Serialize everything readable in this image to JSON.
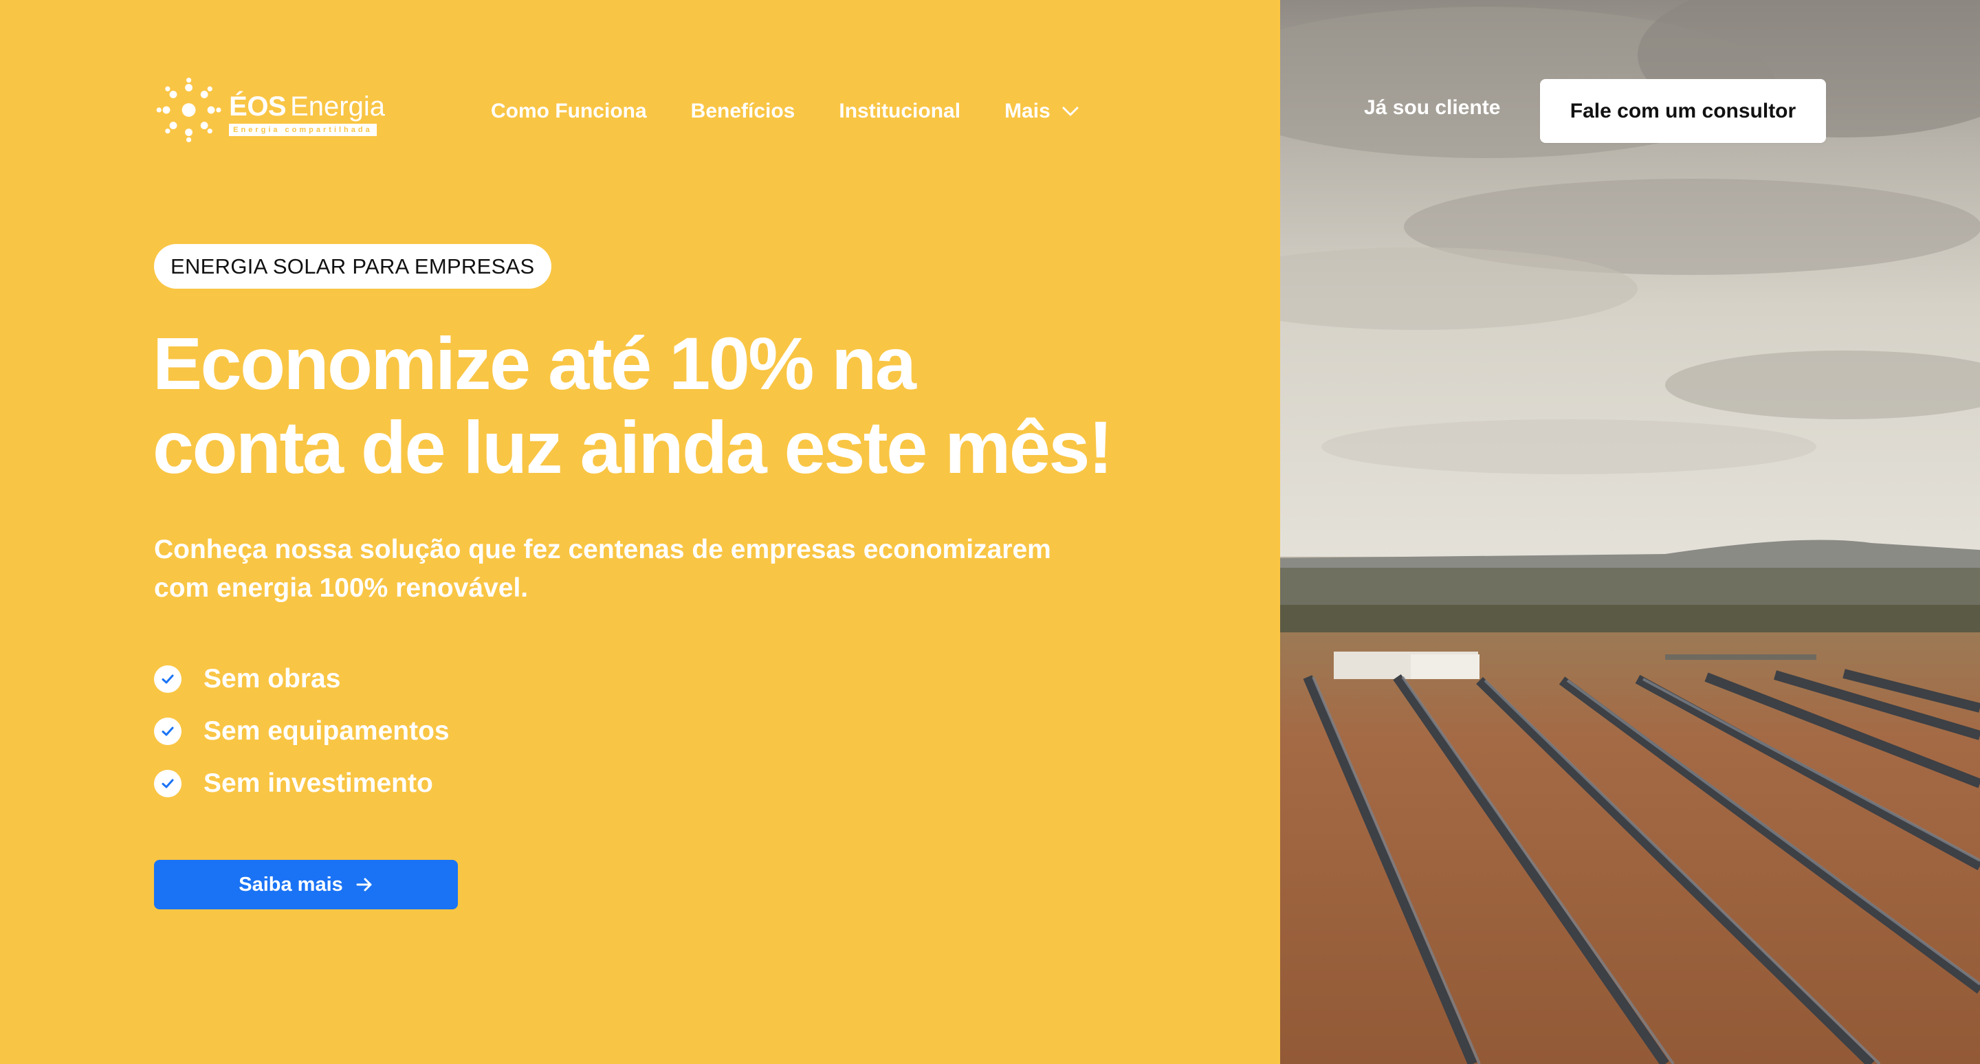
{
  "brand": {
    "name": "ÉOS",
    "name_suffix": "Energia",
    "tagline": "Energia compartilhada"
  },
  "nav": {
    "items": [
      {
        "label": "Como Funciona"
      },
      {
        "label": "Benefícios"
      },
      {
        "label": "Institucional"
      },
      {
        "label": "Mais",
        "icon": "chevron-down-icon"
      }
    ],
    "client_link": "Já sou cliente",
    "consultant_button": "Fale com um consultor"
  },
  "hero": {
    "eyebrow": "ENERGIA SOLAR PARA EMPRESAS",
    "headline_line1": "Economize até 10% na",
    "headline_line2": "conta de luz ainda este mês!",
    "subtitle_line1": "Conheça nossa solução que fez centenas de empresas economizarem",
    "subtitle_line2": "com energia 100% renovável.",
    "features": [
      {
        "label": "Sem obras",
        "icon": "check-circle-icon"
      },
      {
        "label": "Sem equipamentos",
        "icon": "check-circle-icon"
      },
      {
        "label": "Sem investimento",
        "icon": "check-circle-icon"
      }
    ],
    "cta_label": "Saiba mais",
    "cta_icon": "arrow-right-icon"
  },
  "image": {
    "subject": "solar-farm-photo"
  },
  "colors": {
    "brand_yellow": "#F9C544",
    "cta_blue": "#1A73F5",
    "check_blue": "#1A73F5",
    "white": "#FFFFFF"
  }
}
